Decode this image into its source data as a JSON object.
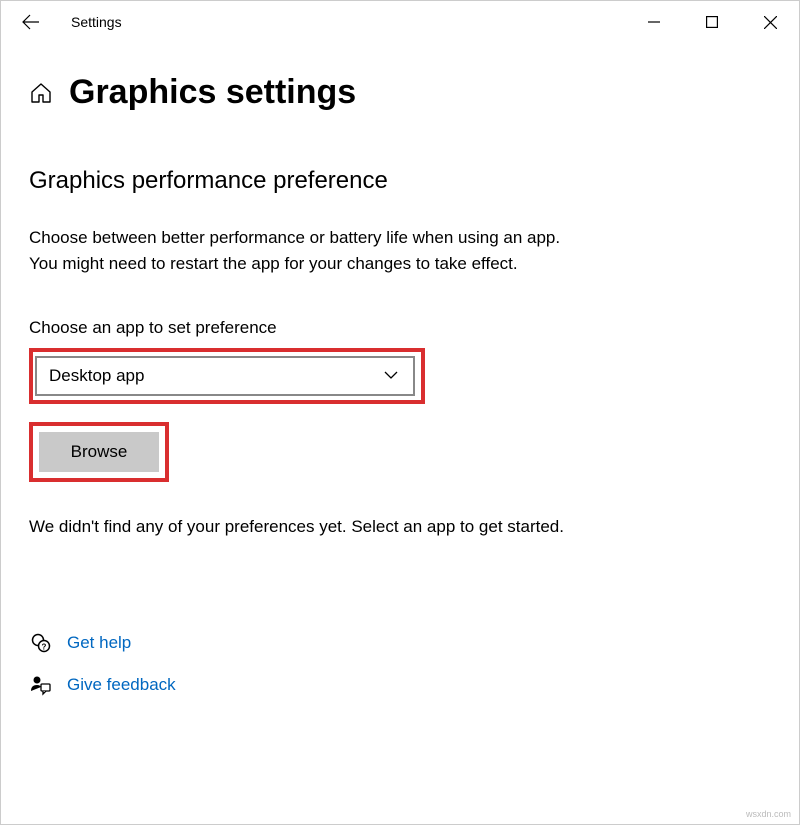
{
  "titlebar": {
    "title": "Settings"
  },
  "page": {
    "title": "Graphics settings"
  },
  "section": {
    "heading": "Graphics performance preference",
    "description_line1": "Choose between better performance or battery life when using an app.",
    "description_line2": "You might need to restart the app for your changes to take effect.",
    "choose_label": "Choose an app to set preference",
    "dropdown_value": "Desktop app",
    "browse_label": "Browse",
    "empty_state": "We didn't find any of your preferences yet. Select an app to get started."
  },
  "links": {
    "help": "Get help",
    "feedback": "Give feedback"
  },
  "watermark": "wsxdn.com"
}
